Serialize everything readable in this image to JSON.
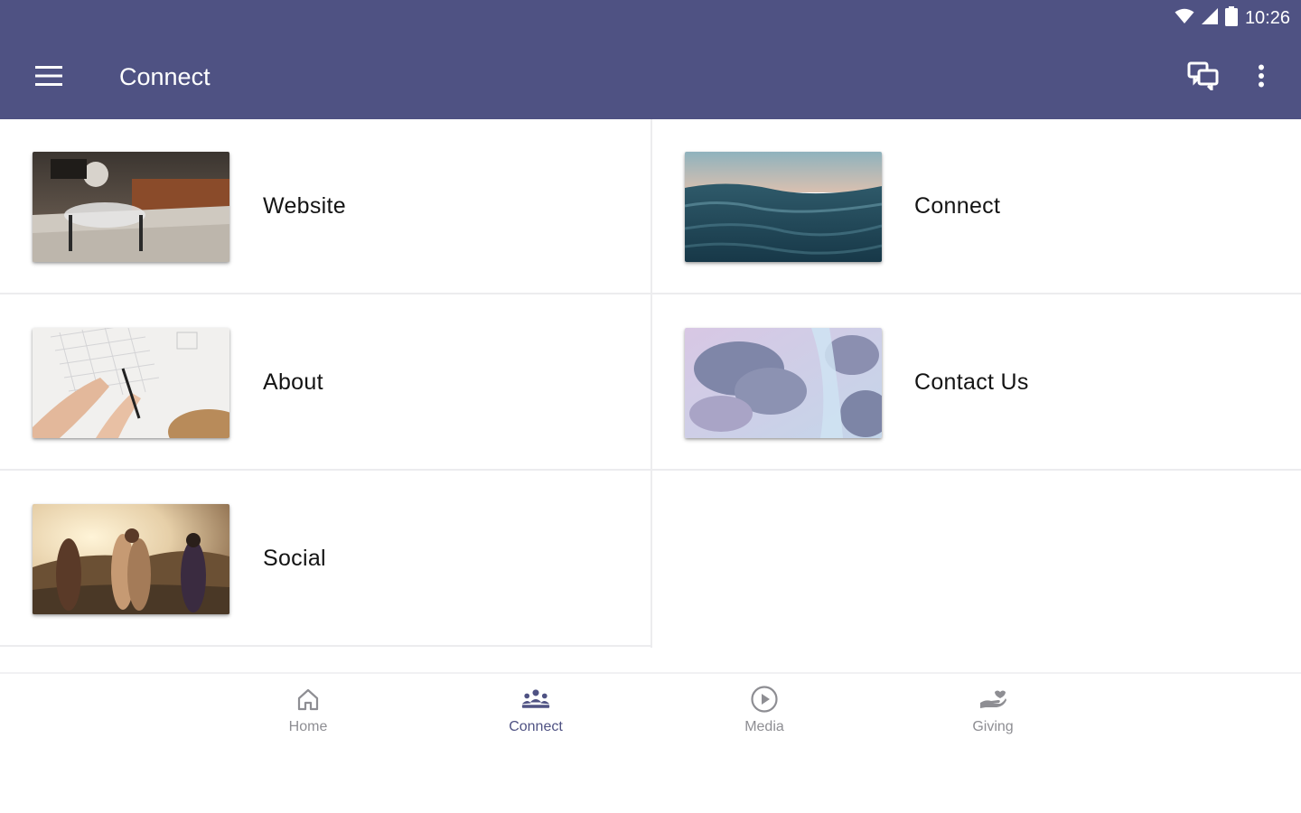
{
  "status_bar": {
    "time": "10:26",
    "icons": [
      "wifi-icon",
      "cell-signal-icon",
      "battery-icon"
    ]
  },
  "app_bar": {
    "title": "Connect",
    "menu_icon": "hamburger-menu-icon",
    "actions": [
      "chat-icon",
      "more-vert-icon"
    ],
    "color": "#4f5283"
  },
  "tiles": [
    {
      "label": "Website",
      "image": "living-room-photo"
    },
    {
      "label": "Connect",
      "image": "ocean-waves-photo"
    },
    {
      "label": "About",
      "image": "hands-writing-photo"
    },
    {
      "label": "Contact Us",
      "image": "pastel-clouds-photo"
    },
    {
      "label": "Social",
      "image": "friends-sunset-photo"
    }
  ],
  "bottom_nav": {
    "active": "Connect",
    "items": [
      {
        "label": "Home",
        "icon": "home-icon"
      },
      {
        "label": "Connect",
        "icon": "people-icon"
      },
      {
        "label": "Media",
        "icon": "play-circle-icon"
      },
      {
        "label": "Giving",
        "icon": "giving-hand-icon"
      }
    ]
  },
  "colors": {
    "primary": "#4f5283",
    "text": "#141414",
    "nav_inactive": "#8e8e93",
    "divider": "#ececee"
  }
}
